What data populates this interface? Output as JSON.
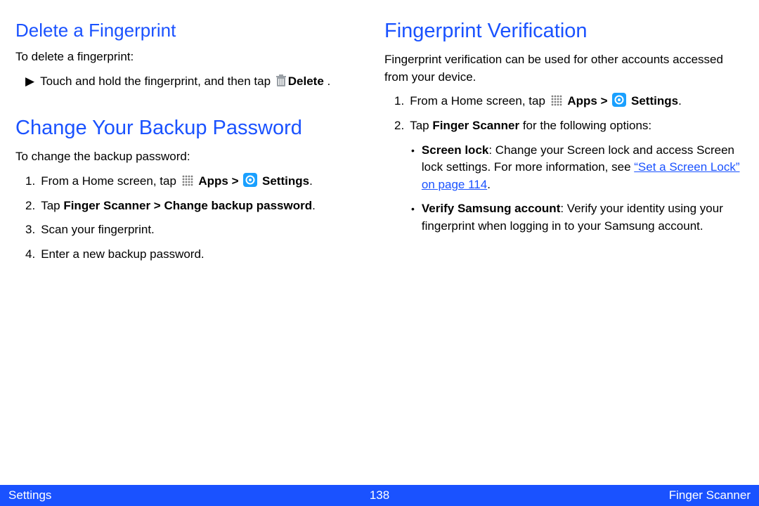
{
  "left": {
    "section1": {
      "heading": "Delete a Fingerprint",
      "intro": "To delete a fingerprint:",
      "step1_pre": "Touch and hold the fingerprint, and then tap ",
      "step1_bold": "Delete",
      "step1_post": " ."
    },
    "section2": {
      "heading": "Change Your Backup Password",
      "intro": "To change the backup password:",
      "step1_pre": "From a Home screen, tap ",
      "step1_apps": "Apps",
      "step1_gt": " > ",
      "step1_settings": "Settings",
      "step1_post": ".",
      "step2_pre": "Tap ",
      "step2_bold": "Finger Scanner > Change backup password",
      "step2_post": ".",
      "step3": "Scan your fingerprint.",
      "step4": "Enter a new backup password."
    }
  },
  "right": {
    "heading": "Fingerprint Verification",
    "intro": "Fingerprint verification can be used for other accounts accessed from your device.",
    "step1_pre": "From a Home screen, tap ",
    "step1_apps": "Apps",
    "step1_gt": " > ",
    "step1_settings": "Settings",
    "step1_post": ".",
    "step2_pre": "Tap ",
    "step2_bold": "Finger Scanner",
    "step2_post": " for the following options:",
    "bullet1_label": "Screen lock",
    "bullet1_text1": ": Change your Screen lock and access Screen lock settings. For more information, see ",
    "bullet1_link": "“Set a Screen Lock” on page 114",
    "bullet1_text2": ".",
    "bullet2_label": "Verify Samsung account",
    "bullet2_text": ": Verify your identity using your fingerprint when logging in to your Samsung account."
  },
  "footer": {
    "left": "Settings",
    "center": "138",
    "right": "Finger Scanner"
  },
  "markers": {
    "triangle": "▶",
    "one": "1.",
    "two": "2.",
    "three": "3.",
    "four": "4.",
    "bullet": "•"
  }
}
